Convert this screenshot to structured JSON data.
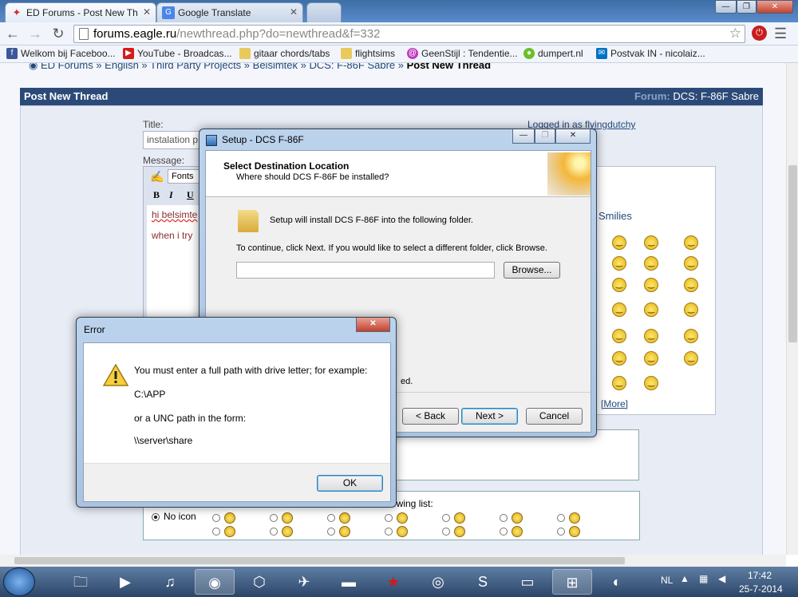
{
  "browser": {
    "tabs": [
      {
        "title": "ED Forums - Post New Th",
        "active": true
      },
      {
        "title": "Google Translate",
        "active": false
      }
    ],
    "url_host": "forums.eagle.ru",
    "url_path": "/newthread.php?do=newthread&f=332",
    "bookmarks": [
      "Welkom bij Faceboo...",
      "YouTube - Broadcas...",
      "gitaar chords/tabs",
      "flightsims",
      "GeenStijl : Tendentie...",
      "dumpert.nl",
      "Postvak IN - nicolaiz..."
    ]
  },
  "forum": {
    "breadcrumb_parts": [
      "ED Forums",
      "English",
      "Third Party Projects",
      "Belsimtek",
      "DCS: F-86F Sabre"
    ],
    "breadcrumb_current": "Post New Thread",
    "thread_bar_title": "Post New Thread",
    "forum_label": "Forum:",
    "forum_name": "DCS: F-86F Sabre",
    "title_label": "Title:",
    "title_value": "instalation p",
    "logged_in": "Logged in as flyingdutchy",
    "message_label": "Message:",
    "font_label": "Fonts",
    "message_lines": [
      "hi belsimte",
      "when i try"
    ],
    "smilies_title": "Smilies",
    "smilies_more": "[More]",
    "icons_text": "owing list:",
    "no_icon": "No icon"
  },
  "setup_dialog": {
    "title": "Setup - DCS F-86F",
    "heading": "Select Destination Location",
    "subheading": "Where should DCS F-86F be installed?",
    "install_text": "Setup will install DCS F-86F into the following folder.",
    "continue_text": "To continue, click Next. If you would like to select a different folder, click Browse.",
    "path_value": "",
    "browse": "Browse...",
    "partial_text": "ed.",
    "back": "< Back",
    "next": "Next >",
    "cancel": "Cancel"
  },
  "error_dialog": {
    "title": "Error",
    "line1": "You must enter a full path with drive letter; for example:",
    "line2": "C:\\APP",
    "line3": "or a UNC path in the form:",
    "line4": "\\\\server\\share",
    "ok": "OK"
  },
  "taskbar": {
    "lang": "NL",
    "time": "17:42",
    "date": "25-7-2014"
  }
}
